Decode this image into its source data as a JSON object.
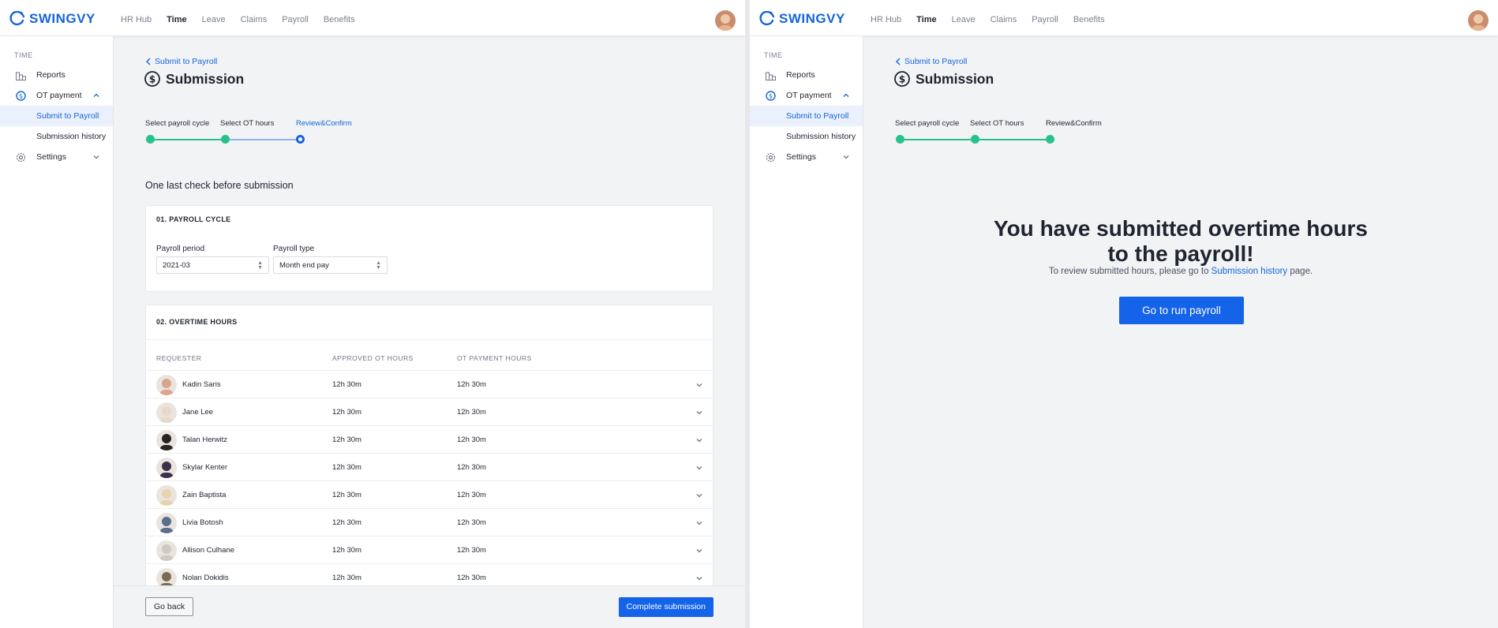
{
  "brand": {
    "name": "SWINGVY",
    "color": "#1565d8"
  },
  "nav": [
    "HR Hub",
    "Time",
    "Leave",
    "Claims",
    "Payroll",
    "Benefits"
  ],
  "nav_active": "Time",
  "sidebar": {
    "section": "TIME",
    "reports": "Reports",
    "ot_payment": "OT payment",
    "submit_to_payroll": "Submit to Payroll",
    "submission_history": "Submission history",
    "settings": "Settings"
  },
  "page": {
    "back_link": "Submit to Payroll",
    "title": "Submission"
  },
  "steps": [
    "Select payroll cycle",
    "Select OT hours",
    "Review&Confirm"
  ],
  "review": {
    "heading": "One last check before submission",
    "card1_heading": "01. PAYROLL CYCLE",
    "payroll_period_label": "Payroll period",
    "payroll_period_value": "2021-03",
    "payroll_type_label": "Payroll type",
    "payroll_type_value": "Month end pay",
    "card2_heading": "02. OVERTIME HOURS",
    "col_requester": "REQUESTER",
    "col_approved": "APPROVED OT HOURS",
    "col_payment": "OT PAYMENT HOURS",
    "rows": [
      {
        "name": "Kadin Saris",
        "approved": "12h 30m",
        "payment": "12h 30m",
        "avatar_color": "#d9a58c"
      },
      {
        "name": "Jane Lee",
        "approved": "12h 30m",
        "payment": "12h 30m",
        "avatar_color": "#e7d9c9"
      },
      {
        "name": "Talan Herwitz",
        "approved": "12h 30m",
        "payment": "12h 30m",
        "avatar_color": "#2a2420"
      },
      {
        "name": "Skylar Kenter",
        "approved": "12h 30m",
        "payment": "12h 30m",
        "avatar_color": "#3b2f4a"
      },
      {
        "name": "Zain Baptista",
        "approved": "12h 30m",
        "payment": "12h 30m",
        "avatar_color": "#e8d3b0"
      },
      {
        "name": "Livia Botosh",
        "approved": "12h 30m",
        "payment": "12h 30m",
        "avatar_color": "#5a6f8a"
      },
      {
        "name": "Allison Culhane",
        "approved": "12h 30m",
        "payment": "12h 30m",
        "avatar_color": "#cfc9c2"
      },
      {
        "name": "Nolan Dokidis",
        "approved": "12h 30m",
        "payment": "12h 30m",
        "avatar_color": "#7a6a52"
      }
    ],
    "go_back": "Go back",
    "complete": "Complete submission"
  },
  "success": {
    "heading_line1": "You have submitted overtime hours",
    "heading_line2": "to the payroll!",
    "sub_prefix": "To review submitted hours, please go to",
    "sub_link": "Submission history",
    "sub_suffix": "page.",
    "button": "Go to run payroll"
  },
  "colors": {
    "primary": "#1463e8",
    "success": "#27c28a"
  }
}
